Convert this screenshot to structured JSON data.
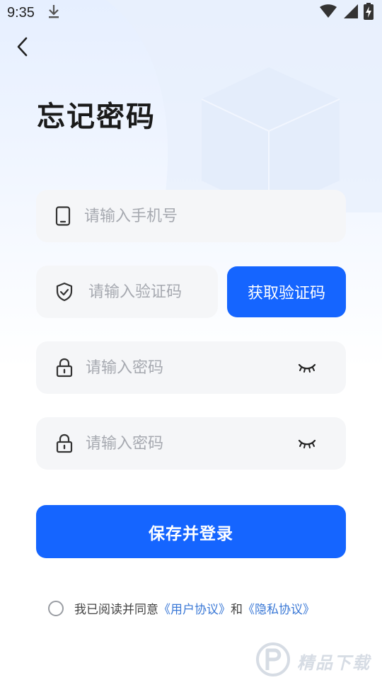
{
  "status_bar": {
    "time": "9:35",
    "icons": [
      "download-icon",
      "wifi-icon",
      "signal-icon",
      "battery-charging-icon"
    ]
  },
  "nav": {
    "back_icon": "chevron-left-icon"
  },
  "page": {
    "title": "忘记密码"
  },
  "form": {
    "phone": {
      "placeholder": "请输入手机号",
      "value": "",
      "icon": "phone-icon"
    },
    "code": {
      "placeholder": "请输入验证码",
      "value": "",
      "icon": "shield-check-icon"
    },
    "get_code_label": "获取验证码",
    "password": {
      "placeholder": "请输入密码",
      "value": "",
      "icon": "lock-icon",
      "toggle_icon": "eye-closed-icon"
    },
    "confirm_password": {
      "placeholder": "请输入密码",
      "value": "",
      "icon": "lock-icon",
      "toggle_icon": "eye-closed-icon"
    },
    "submit_label": "保存并登录"
  },
  "agreement": {
    "checked": false,
    "prefix": "我已阅读并同意",
    "user_agreement": "《用户协议》",
    "conjunction": "和",
    "privacy_policy": "《隐私协议》"
  },
  "watermark": {
    "text": "精品下载"
  },
  "colors": {
    "primary": "#1565ff",
    "link": "#3a78d6",
    "field_bg": "#f5f6f8",
    "placeholder": "#a6a9b0"
  }
}
